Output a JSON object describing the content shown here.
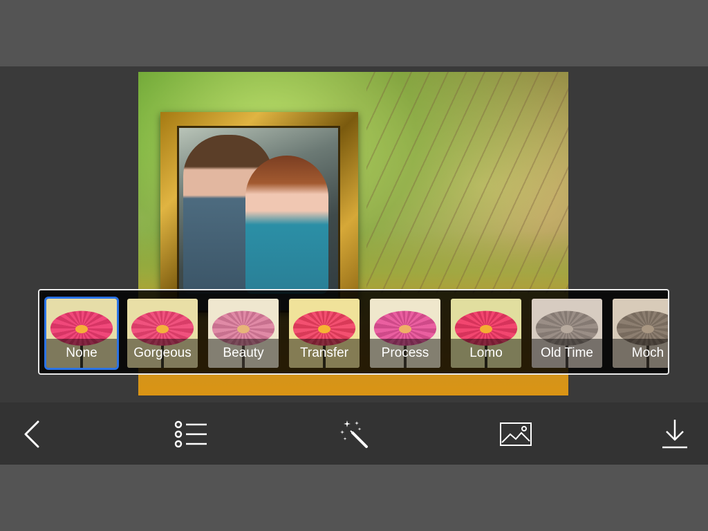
{
  "filters": [
    {
      "label": "None",
      "selected": true,
      "bg": "#e6dda8",
      "petal": "#f0487a",
      "petal2": "#d73565",
      "center": "#f5b03a",
      "stem": "#3a3a2a"
    },
    {
      "label": "Gorgeous",
      "selected": false,
      "bg": "#e9dfa6",
      "petal": "#f0527e",
      "petal2": "#d93d68",
      "center": "#f3b13d",
      "stem": "#3b3a28"
    },
    {
      "label": "Beauty",
      "selected": false,
      "bg": "#efe7cf",
      "petal": "#e08aa6",
      "petal2": "#c8718f",
      "center": "#e7b57a",
      "stem": "#5a5046"
    },
    {
      "label": "Transfer",
      "selected": false,
      "bg": "#f0e29a",
      "petal": "#f35070",
      "petal2": "#d93a58",
      "center": "#f6b434",
      "stem": "#3b3622"
    },
    {
      "label": "Process",
      "selected": false,
      "bg": "#efe7cc",
      "petal": "#ea5fa0",
      "petal2": "#cf4a89",
      "center": "#efb067",
      "stem": "#4a4436"
    },
    {
      "label": "Lomo",
      "selected": false,
      "bg": "#e1de9f",
      "petal": "#f2466f",
      "petal2": "#d7335b",
      "center": "#f4ae33",
      "stem": "#363424"
    },
    {
      "label": "Old Time",
      "selected": false,
      "bg": "#d7ccc1",
      "petal": "#9a8e86",
      "petal2": "#857a73",
      "center": "#b7aa9e",
      "stem": "#4b443f"
    },
    {
      "label": "Moch",
      "selected": false,
      "bg": "#d8cbb9",
      "petal": "#8c7e70",
      "petal2": "#786b5e",
      "center": "#a99782",
      "stem": "#4a4036"
    }
  ],
  "toolbar": {
    "back": "chevron-left-icon",
    "frames": "list-icon",
    "effects": "magic-wand-icon",
    "gallery": "image-icon",
    "save": "download-icon"
  },
  "colors": {
    "background": "#545454",
    "stage": "#3a3a3a",
    "toolbar": "#333333",
    "selection": "#2b73e6"
  }
}
